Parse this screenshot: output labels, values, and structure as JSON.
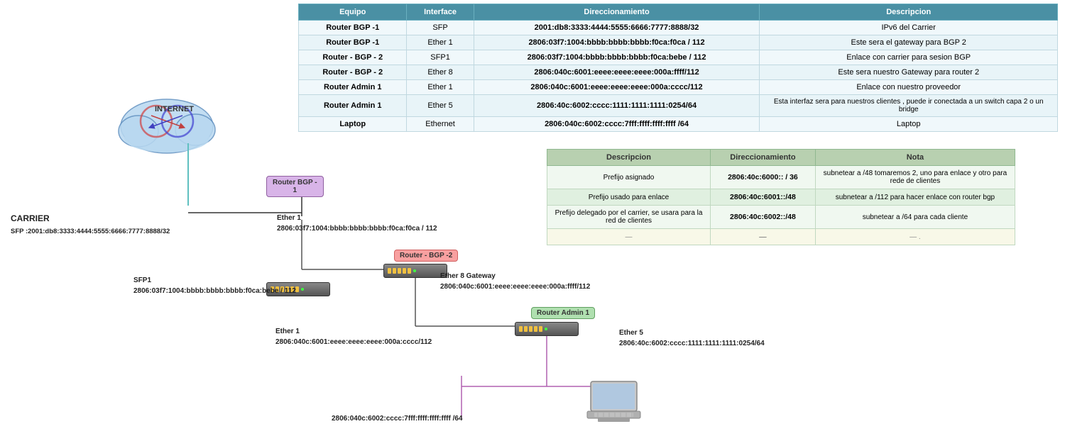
{
  "table": {
    "headers": [
      "Equipo",
      "Interface",
      "Direccionamiento",
      "Descripcion"
    ],
    "rows": [
      {
        "equipo": "Router BGP -1",
        "interface": "SFP",
        "direccionamiento": "2001:db8:3333:4444:5555:6666:7777:8888/32",
        "descripcion": "IPv6 del Carrier"
      },
      {
        "equipo": "Router BGP -1",
        "interface": "Ether 1",
        "direccionamiento": "2806:03f7:1004:bbbb:bbbb:bbbb:f0ca:f0ca / 112",
        "descripcion": "Este sera el gateway para BGP 2"
      },
      {
        "equipo": "Router - BGP - 2",
        "interface": "SFP1",
        "direccionamiento": "2806:03f7:1004:bbbb:bbbb:bbbb:f0ca:bebe / 112",
        "descripcion": "Enlace con carrier para sesion BGP"
      },
      {
        "equipo": "Router - BGP - 2",
        "interface": "Ether 8",
        "direccionamiento": "2806:040c:6001:eeee:eeee:eeee:000a:ffff/112",
        "descripcion": "Este sera nuestro Gateway para router 2"
      },
      {
        "equipo": "Router Admin 1",
        "interface": "Ether 1",
        "direccionamiento": "2806:040c:6001:eeee:eeee:eeee:000a:cccc/112",
        "descripcion": "Enlace con nuestro proveedor"
      },
      {
        "equipo": "Router Admin 1",
        "interface": "Ether 5",
        "direccionamiento": "2806:40c:6002:cccc:1111:1111:1111:0254/64",
        "descripcion": "Esta interfaz sera para nuestros clientes , puede ir conectada a un switch capa 2 o un bridge"
      },
      {
        "equipo": "Laptop",
        "interface": "Ethernet",
        "direccionamiento": "2806:040c:6002:cccc:7fff:ffff:ffff:ffff /64",
        "descripcion": "Laptop"
      }
    ]
  },
  "lower_table": {
    "headers": [
      "Descripcion",
      "Direccionamiento",
      "Nota"
    ],
    "rows": [
      {
        "desc": "Prefijo asignado",
        "dir": "2806:40c:6000:: / 36",
        "nota": "subnetear a /48  tomaremos 2, uno para enlace y otro para rede de clientes"
      },
      {
        "desc": "Prefijo usado para enlace",
        "dir": "2806:40c:6001::/48",
        "nota": "subnetear a /112 para hacer enlace con router bgp"
      },
      {
        "desc": "Prefijo delegado por el carrier, se usara para la red de clientes",
        "dir": "2806:40c:6002::/48",
        "nota": "subnetear a /64 para cada cliente"
      },
      {
        "desc": "—",
        "dir": "—",
        "nota": "—  ."
      }
    ]
  },
  "diagram": {
    "internet_label": "INTERNET",
    "carrier_label": "CARRIER\nSFP :2001:db8:3333:4444:5555:6666:7777:8888/32",
    "router_bgp1": {
      "label": "Router BGP -\n1",
      "ether1_label": "Ether 1",
      "ether1_addr": "2806:03f7:1004:bbbb:bbbb:bbbb:f0ca:f0ca / 112"
    },
    "router_bgp2": {
      "label": "Router - BGP -2",
      "sfp1_label": "SFP1",
      "sfp1_addr": "2806:03f7:1004:bbbb:bbbb:bbbb:f0ca:bebe / 112",
      "ether8_label": "Ether 8 Gateway",
      "ether8_addr": "2806:040c:6001:eeee:eeee:eeee:000a:ffff/112"
    },
    "router_admin1": {
      "label": "Router Admin 1",
      "ether1_label": "Ether 1",
      "ether1_addr": "2806:040c:6001:eeee:eeee:eeee:000a:cccc/112",
      "ether5_label": "Ether 5",
      "ether5_addr": "2806:40c:6002:cccc:1111:1111:1111:0254/64"
    },
    "laptop_addr": "2806:040c:6002:cccc:7fff:ffff:ffff:ffff /64"
  }
}
